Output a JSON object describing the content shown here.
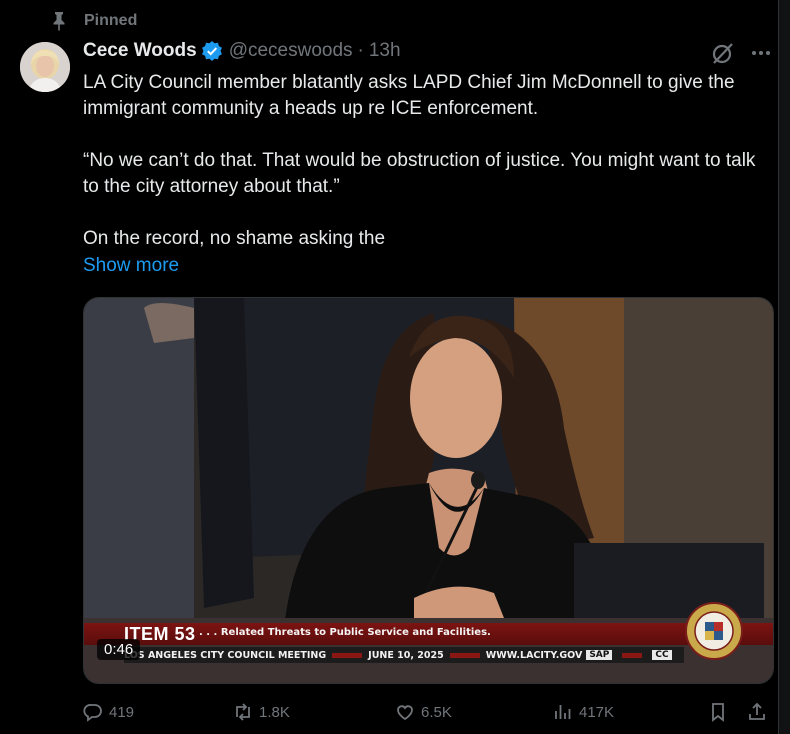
{
  "pinned_label": "Pinned",
  "author": {
    "name": "Cece Woods",
    "handle": "@ceceswoods",
    "separator": "·",
    "time": "13h"
  },
  "tweet": {
    "paragraphs": [
      "LA City Council member blatantly asks LAPD Chief Jim McDonnell to give the immigrant community a heads up re ICE enforcement.",
      "“No we can’t do that. That would be obstruction of justice. You might want to talk to the city attorney about that.”",
      "On the record, no shame asking the"
    ],
    "show_more": "Show more"
  },
  "video": {
    "duration": "0:46",
    "item_label": "ITEM 53",
    "item_desc": ". . . Related Threats to Public Service and Facilities.",
    "meeting": "LOS ANGELES CITY COUNCIL MEETING",
    "date": "JUNE 10, 2025",
    "site": "WWW.LACITY.GOV",
    "chip_sap": "SAP",
    "chip_cc": "CC"
  },
  "actions": {
    "replies": "419",
    "reposts": "1.8K",
    "likes": "6.5K",
    "views": "417K"
  },
  "colors": {
    "background": "#000000",
    "text": "#e7e9ea",
    "muted": "#71767b",
    "link": "#1d9bf0",
    "verified": "#1d9bf0",
    "banner_red": "#7c1412"
  },
  "icons": [
    "pin-icon",
    "verified-badge-icon",
    "grok-icon",
    "more-icon",
    "reply-icon",
    "repost-icon",
    "like-icon",
    "views-icon",
    "bookmark-icon",
    "share-icon"
  ]
}
